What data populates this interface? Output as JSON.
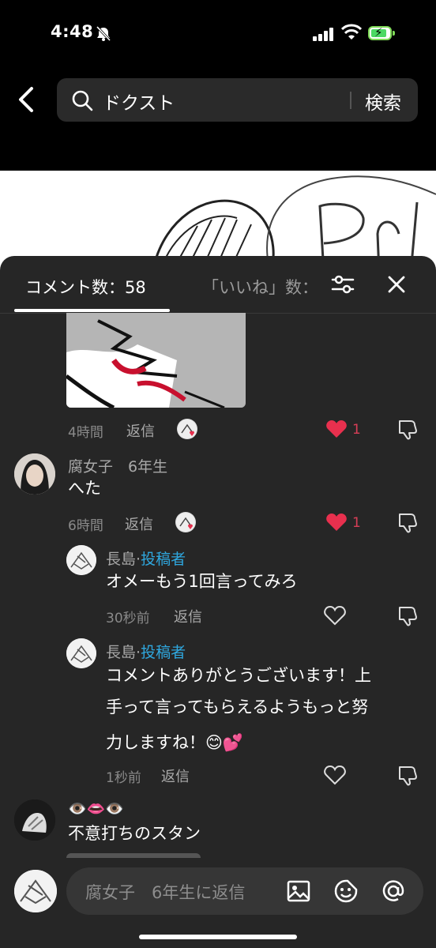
{
  "status_bar": {
    "time": "4:48"
  },
  "search": {
    "query": "ドクスト",
    "button": "検索"
  },
  "tabs": {
    "comment_count": "コメント数：58",
    "likes_count": "「いいね」数："
  },
  "comments": [
    {
      "time": "4時間",
      "reply": "返信",
      "likes": "1"
    },
    {
      "name": "腐女子　6年生",
      "text": "へた",
      "time": "6時間",
      "reply": "返信",
      "likes": "1"
    },
    {
      "name": "長島",
      "dot": "·",
      "role": "投稿者",
      "text": "オメーもう1回言ってみろ",
      "time": "30秒前",
      "reply": "返信"
    },
    {
      "name": "長島",
      "dot": "·",
      "role": "投稿者",
      "text_line1": "コメントありがとうございます！上",
      "text_line2": "手って言ってもらえるようもっと努",
      "text_line3": "力しますね！😊💕",
      "time": "1秒前",
      "reply": "返信"
    },
    {
      "name": "👁️👄👁️",
      "text": "不意打ちのスタン"
    }
  ],
  "reply_input": {
    "placeholder": "腐女子　6年生に返信"
  },
  "colors": {
    "accent_like": "#e8304e",
    "author_tag": "#2fa7de",
    "sheet_bg": "#262626"
  }
}
